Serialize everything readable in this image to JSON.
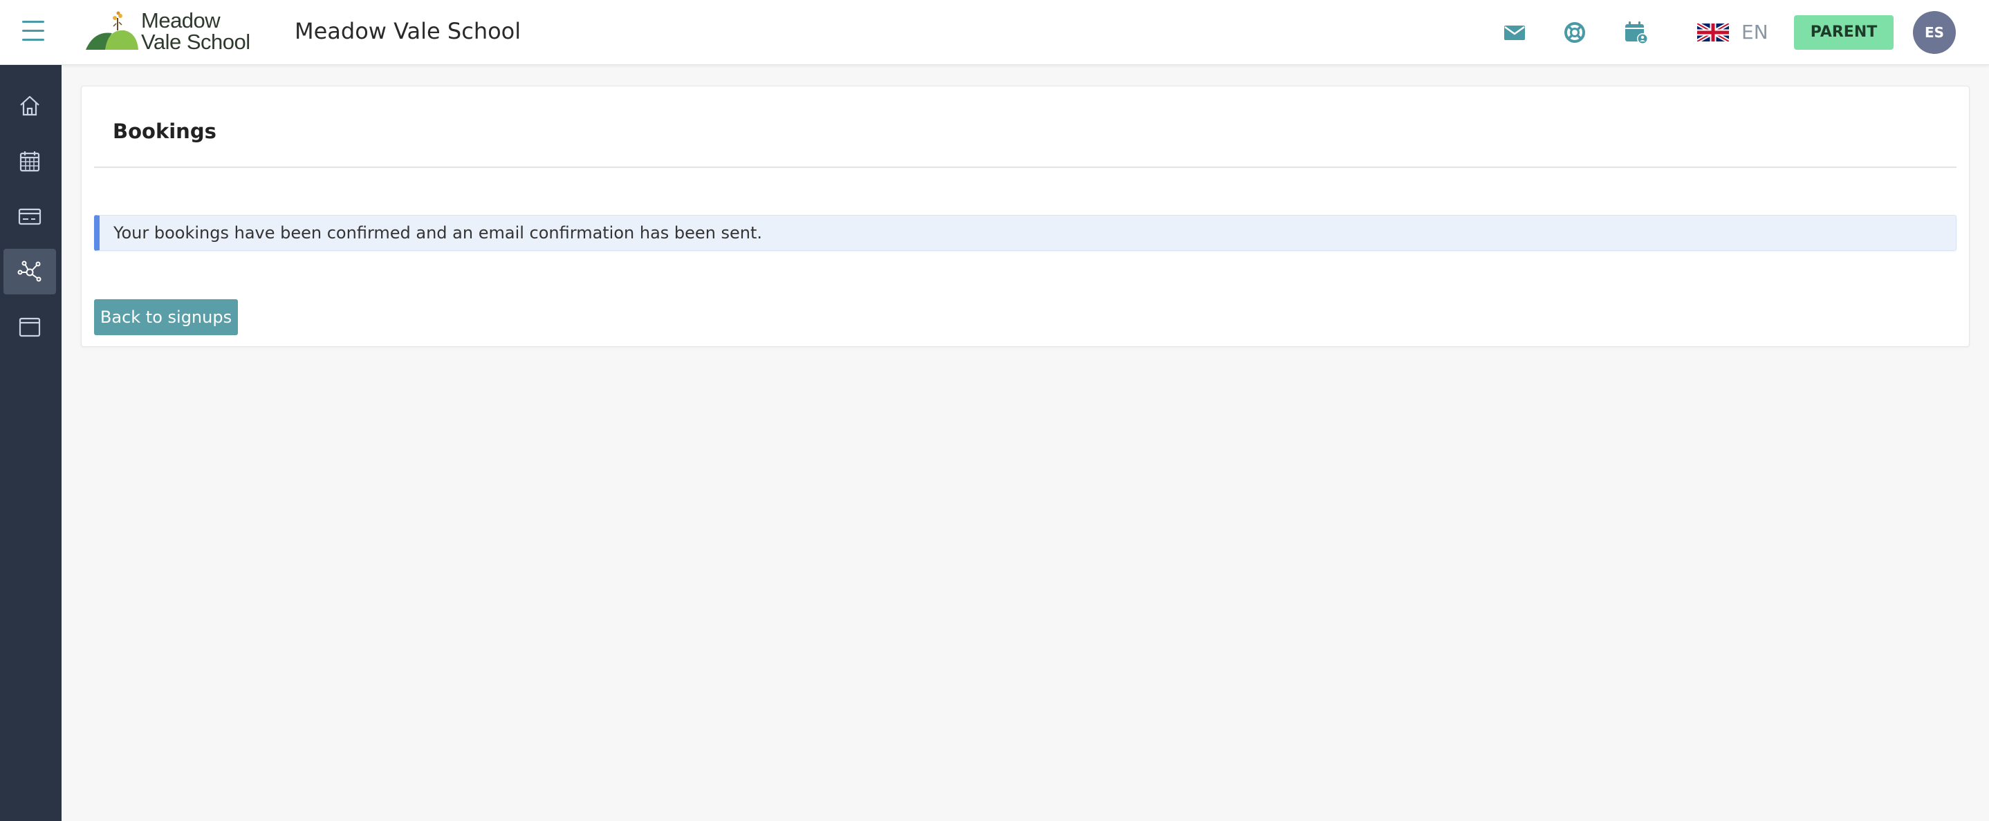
{
  "header": {
    "logo_line1": "Meadow",
    "logo_line2": "Vale School",
    "school_name": "Meadow Vale School",
    "language": "EN",
    "role": "PARENT",
    "user_initials": "ES",
    "icons": [
      "menu-icon",
      "mail-icon",
      "help-lifebuoy-icon",
      "calendar-user-icon",
      "uk-flag-icon"
    ]
  },
  "sidebar": {
    "items": [
      {
        "icon": "home-icon"
      },
      {
        "icon": "calendar-icon"
      },
      {
        "icon": "payment-card-icon"
      },
      {
        "icon": "network-icon",
        "active": true
      },
      {
        "icon": "browser-window-icon"
      }
    ]
  },
  "main": {
    "title": "Bookings",
    "alert": "Your bookings have been confirmed and an email confirmation has been sent.",
    "back_button": "Back to signups"
  },
  "colors": {
    "accent": "#5a9ea7",
    "sidebar_bg": "#2b3445",
    "role_badge": "#7ee0a6",
    "alert_bg": "#eaf1fb",
    "alert_border": "#5b8be6"
  }
}
